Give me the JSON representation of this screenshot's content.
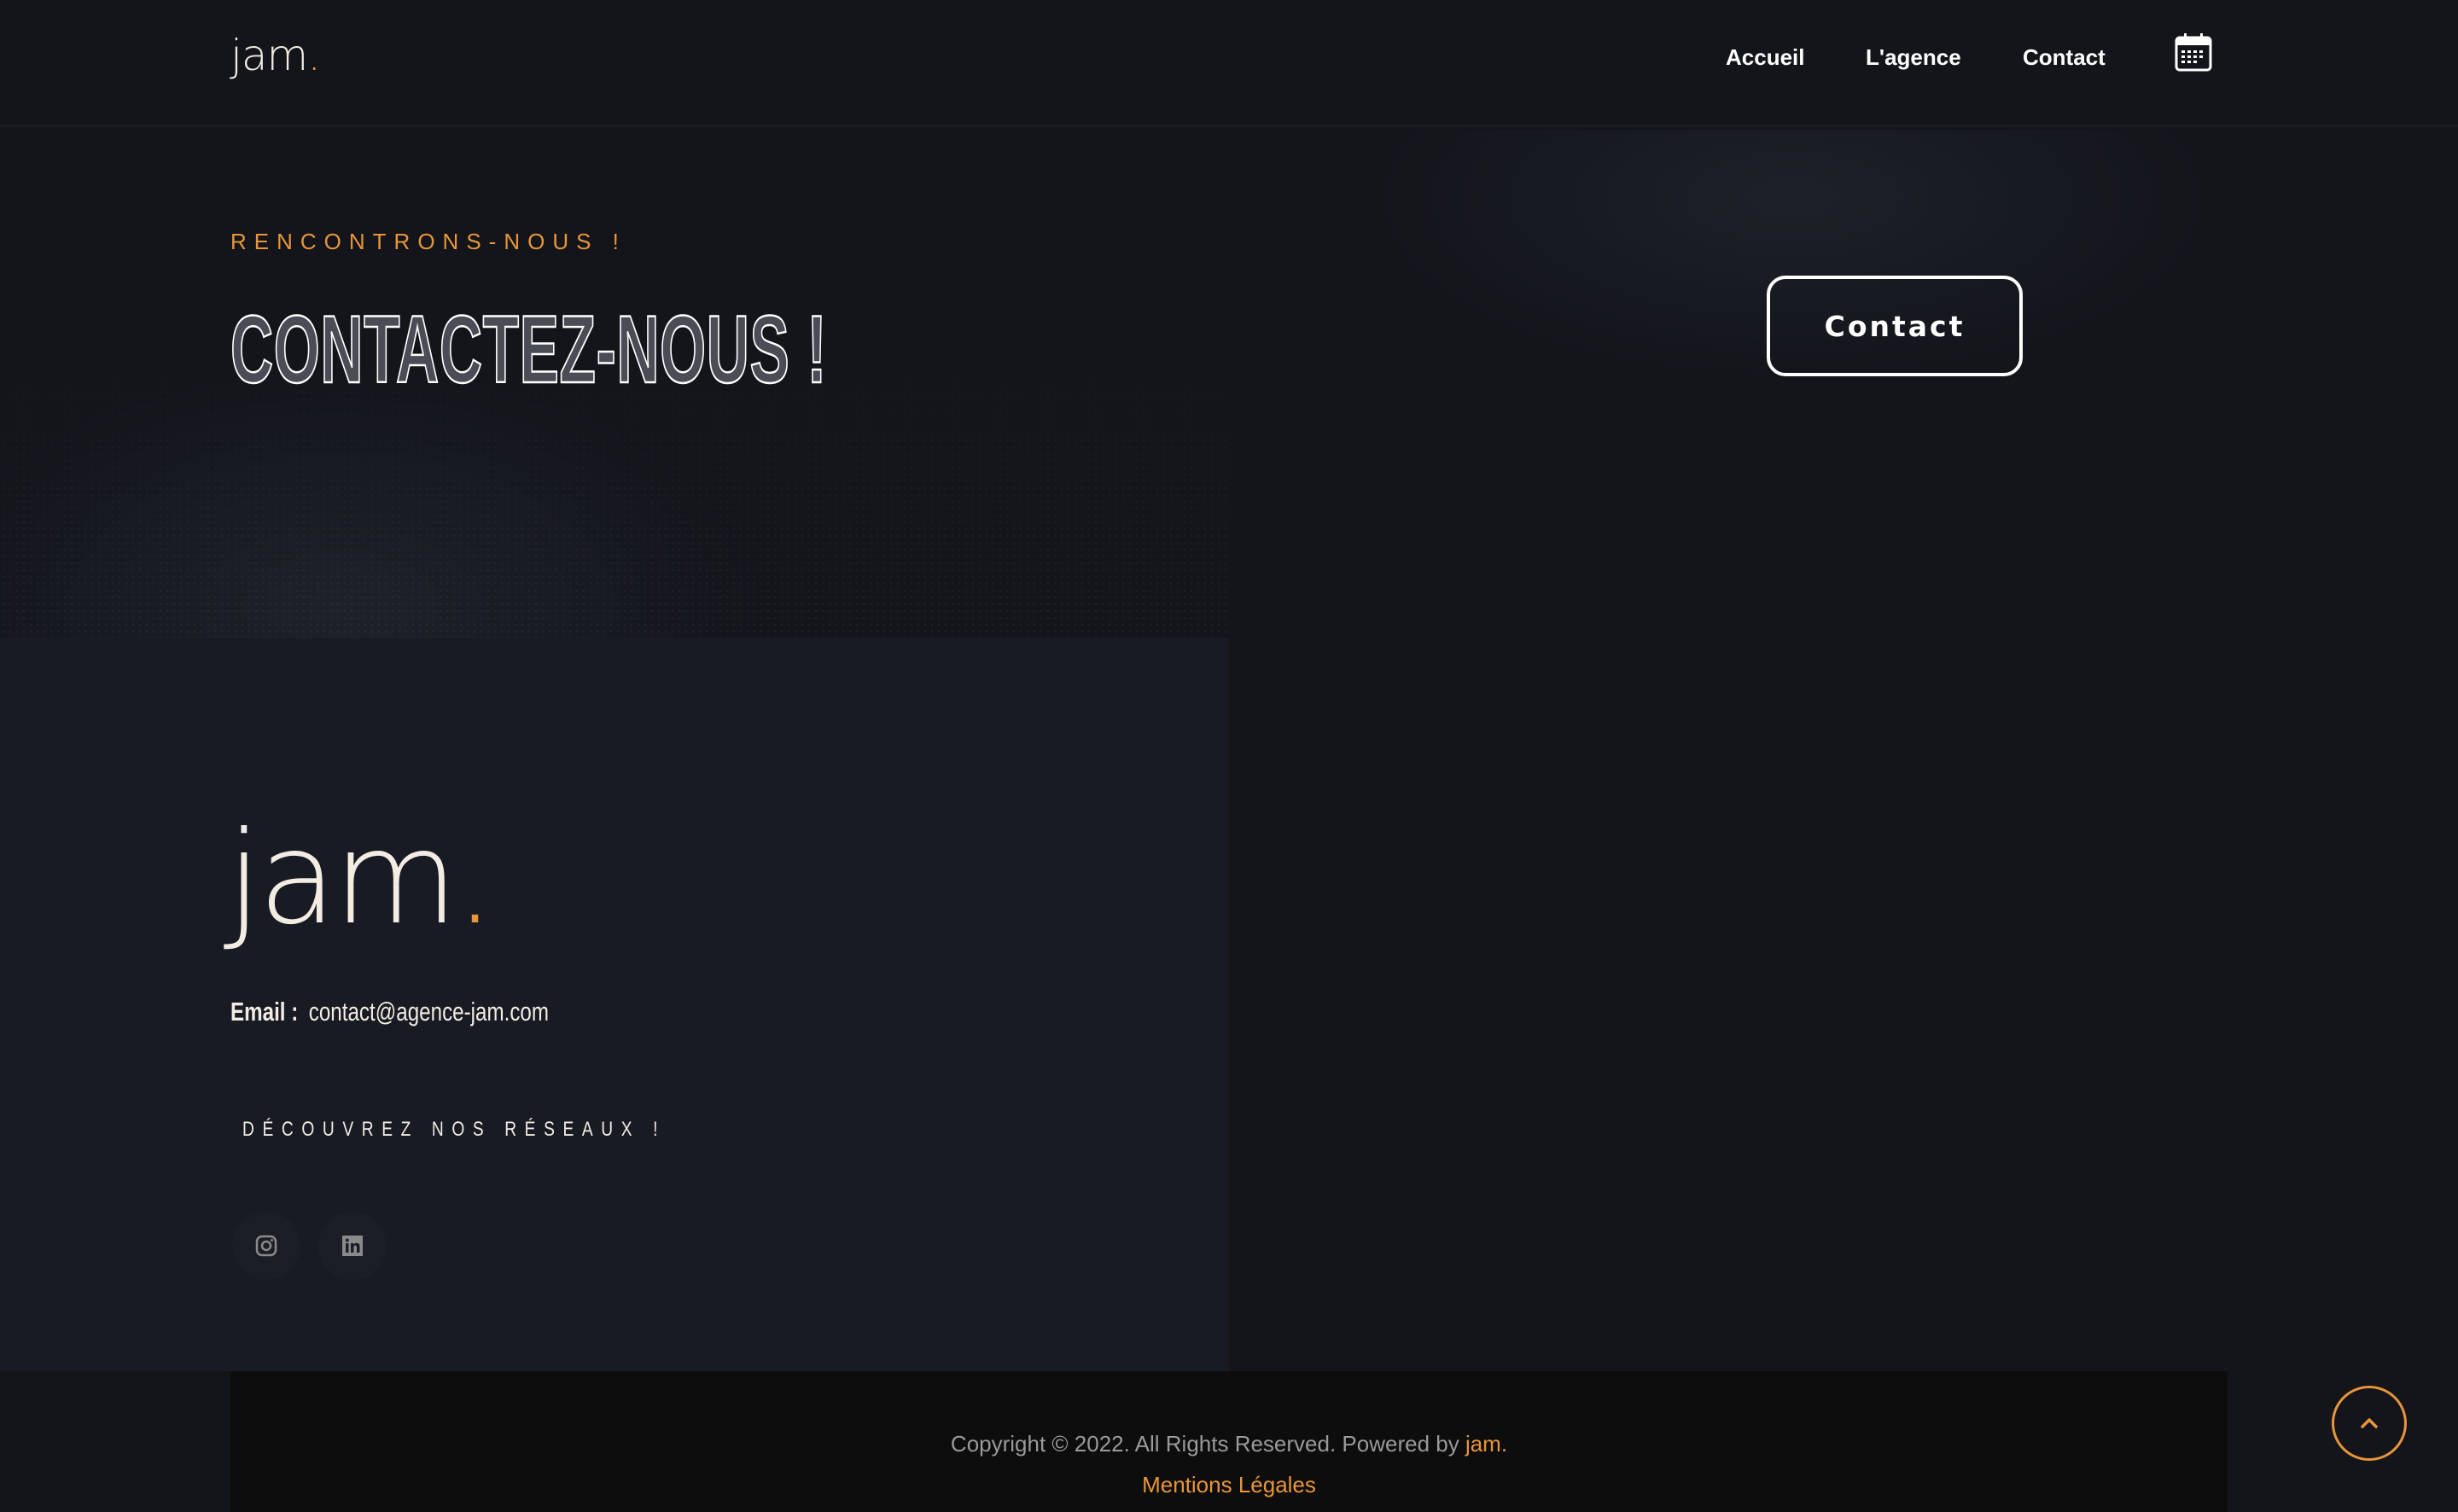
{
  "header": {
    "logo": "jam",
    "logo_dot": ".",
    "nav": [
      "Accueil",
      "L'agence",
      "Contact"
    ],
    "calendar_icon": "calendar-icon"
  },
  "hero": {
    "kicker": "RENCONTRONS-NOUS !",
    "title": "CONTACTEZ-NOUS !",
    "button": "Contact"
  },
  "footer": {
    "logo": "jam",
    "logo_dot": ".",
    "email_label": "Email :",
    "email": "contact@agence-jam.com",
    "social_heading": "DÉCOUVREZ NOS RÉSEAUX !",
    "socials": [
      "instagram-icon",
      "linkedin-icon"
    ],
    "copyright": "Copyright © 2022. All Rights Reserved. Powered by ",
    "powered_by": "jam.",
    "legal": "Mentions Légales"
  },
  "scroll_top_icon": "chevron-up-icon",
  "colors": {
    "accent": "#e8953a",
    "background": "#13151b",
    "panel": "#181b24",
    "footer_bar": "#0d0d0d",
    "logo": "#f2ece3"
  }
}
